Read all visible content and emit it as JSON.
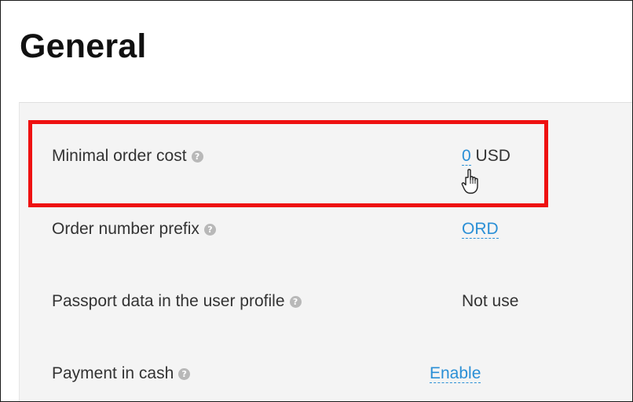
{
  "page": {
    "title": "General"
  },
  "settings": [
    {
      "label": "Minimal order cost",
      "value": "0",
      "unit": "USD",
      "value_style": "link"
    },
    {
      "label": "Order number prefix",
      "value": "ORD",
      "unit": "",
      "value_style": "link"
    },
    {
      "label": "Passport data in the user profile",
      "value": "Not use",
      "unit": "",
      "value_style": "plain"
    },
    {
      "label": "Payment in cash",
      "value": "Enable",
      "unit": "",
      "value_style": "link"
    }
  ],
  "icons": {
    "help": "question-circle-icon",
    "cursor": "hand-pointer-icon"
  },
  "colors": {
    "link": "#2a8fd6",
    "highlight": "#ee1111",
    "panel_bg": "#f4f4f4",
    "help_icon": "#b8b8b8"
  }
}
